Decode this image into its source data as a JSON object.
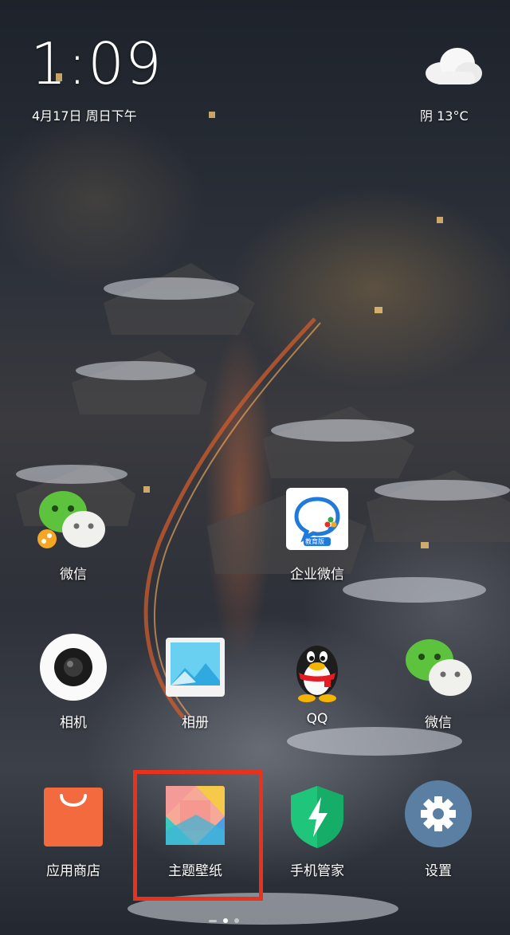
{
  "status": {
    "time": "1:09",
    "date": "4月17日 周日下午",
    "weather": "阴  13°C"
  },
  "weather_icon": "cloud-icon",
  "apps": {
    "wechat1": {
      "label": "微信",
      "icon": "wechat-icon"
    },
    "wework": {
      "label": "企业微信",
      "icon": "wework-icon",
      "badge": "教育版"
    },
    "camera": {
      "label": "相机",
      "icon": "camera-icon"
    },
    "gallery": {
      "label": "相册",
      "icon": "gallery-icon"
    },
    "qq": {
      "label": "QQ",
      "icon": "qq-penguin-icon"
    },
    "wechat2": {
      "label": "微信",
      "icon": "wechat-icon"
    },
    "appstore": {
      "label": "应用商店",
      "icon": "shopping-bag-icon"
    },
    "themes": {
      "label": "主题壁纸",
      "icon": "themes-icon"
    },
    "security": {
      "label": "手机管家",
      "icon": "shield-lightning-icon"
    },
    "settings": {
      "label": "设置",
      "icon": "gear-icon"
    }
  },
  "highlight_color": "#e8321d",
  "page_indicator": {
    "pages": 3,
    "active": 1
  }
}
